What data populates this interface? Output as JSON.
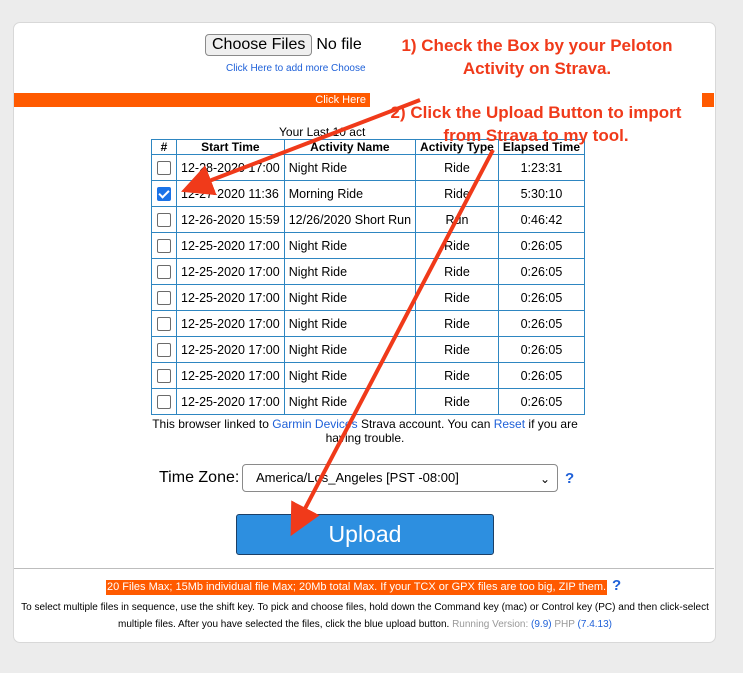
{
  "upload_form": {
    "choose_files_label": "Choose Files",
    "no_file_text": "No file",
    "add_more_link": "Click Here to add more Choose",
    "orange_bar_text": "Click Here",
    "your_last_text": "Your Last 10 act"
  },
  "activities": {
    "headers": [
      "#",
      "Start Time",
      "Activity Name",
      "Activity Type",
      "Elapsed Time"
    ],
    "rows": [
      {
        "checked": false,
        "start": "12-28-2020 17:00",
        "name": "Night Ride",
        "type": "Ride",
        "elapsed": "1:23:31"
      },
      {
        "checked": true,
        "start": "12-27-2020 11:36",
        "name": "Morning Ride",
        "type": "Ride",
        "elapsed": "5:30:10"
      },
      {
        "checked": false,
        "start": "12-26-2020 15:59",
        "name": "12/26/2020 Short Run",
        "type": "Run",
        "elapsed": "0:46:42"
      },
      {
        "checked": false,
        "start": "12-25-2020 17:00",
        "name": "Night Ride",
        "type": "Ride",
        "elapsed": "0:26:05"
      },
      {
        "checked": false,
        "start": "12-25-2020 17:00",
        "name": "Night Ride",
        "type": "Ride",
        "elapsed": "0:26:05"
      },
      {
        "checked": false,
        "start": "12-25-2020 17:00",
        "name": "Night Ride",
        "type": "Ride",
        "elapsed": "0:26:05"
      },
      {
        "checked": false,
        "start": "12-25-2020 17:00",
        "name": "Night Ride",
        "type": "Ride",
        "elapsed": "0:26:05"
      },
      {
        "checked": false,
        "start": "12-25-2020 17:00",
        "name": "Night Ride",
        "type": "Ride",
        "elapsed": "0:26:05"
      },
      {
        "checked": false,
        "start": "12-25-2020 17:00",
        "name": "Night Ride",
        "type": "Ride",
        "elapsed": "0:26:05"
      },
      {
        "checked": false,
        "start": "12-25-2020 17:00",
        "name": "Night Ride",
        "type": "Ride",
        "elapsed": "0:26:05"
      }
    ]
  },
  "linked": {
    "prefix": "This browser linked to ",
    "account_link": "Garmin Devices",
    "middle": " Strava account. You can ",
    "reset_link": "Reset",
    "suffix": " if you are having trouble."
  },
  "timezone": {
    "label": "Time Zone:",
    "selected": "America/Los_Angeles [PST -08:00]",
    "help": "?"
  },
  "upload_button_label": "Upload",
  "footer": {
    "limits": "20 Files Max; 15Mb individual file Max; 20Mb total Max. If your TCX or GPX files are too big, ZIP them.",
    "limits_help": "?",
    "help_text": "To select multiple files in sequence, use the shift key. To pick and choose files, hold down the Command key (mac) or Control key (PC) and then click-select multiple files. After you have selected the files, click the blue upload button.",
    "running_version_label": "Running Version:",
    "version": "(9.9)",
    "php_label": "PHP",
    "php_version": "(7.4.13)"
  },
  "annotations": {
    "step1": "1) Check the Box by your Peloton Activity on Strava.",
    "step2": "2) Click the Upload Button to import from Strava to my tool."
  },
  "colors": {
    "annotation": "#f03a1a",
    "orange_bar": "#ff5a00",
    "table_border": "#2e86c1",
    "upload_button": "#2d8fe0",
    "link": "#1e60d8"
  }
}
